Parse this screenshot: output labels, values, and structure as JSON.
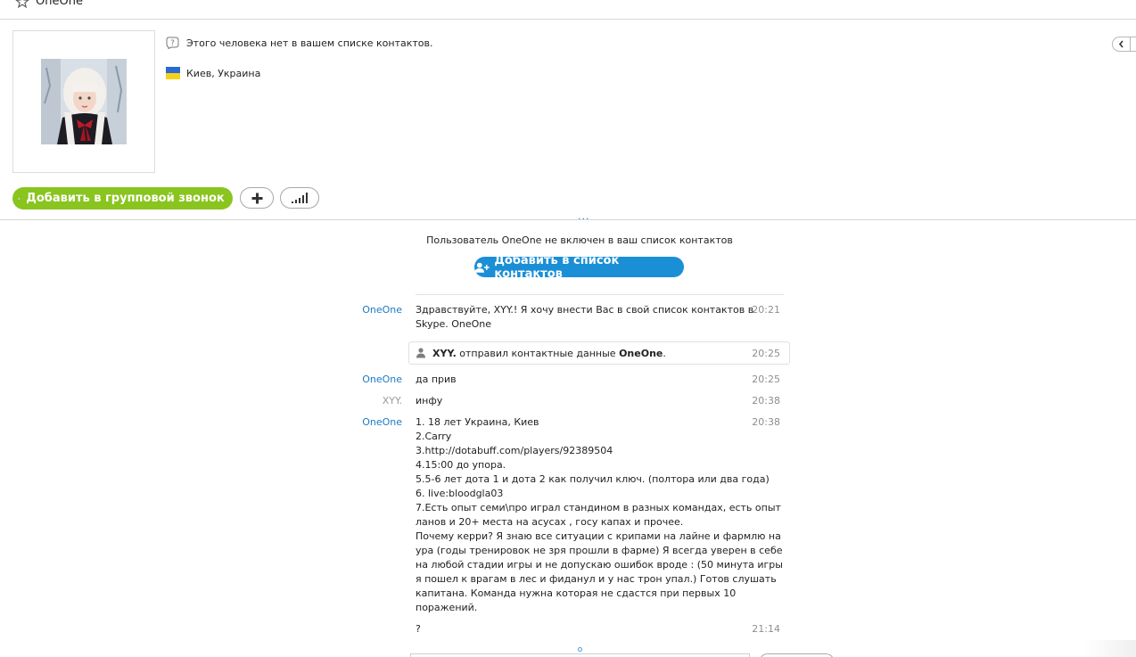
{
  "window": {
    "title": "OneOne"
  },
  "profile": {
    "not_in_contacts": "Этого человека нет в вашем списке контактов.",
    "location": "Киев, Украина",
    "avatar_icon": "user-photo"
  },
  "toolbar": {
    "group_call_label": "Добавить в групповой звонок",
    "add_icon": "plus-icon",
    "signal_icon": "signal-bars-icon"
  },
  "splitter": {
    "grip": "..."
  },
  "chat": {
    "notice": "Пользователь OneOne не включен в ваш список контактов",
    "add_contact_label": "Добавить в список контактов",
    "messages": [
      {
        "sender": "OneOne",
        "time": "20:21",
        "lines": [
          "Здравствуйте, XYY.! Я хочу внести Вас в свой список контактов в",
          "Skype. OneOne"
        ]
      },
      {
        "sender": "OneOne",
        "time": "20:25",
        "lines": [
          "да прив"
        ]
      },
      {
        "sender": "XYY.",
        "time": "20:38",
        "lines": [
          "инфу"
        ]
      },
      {
        "sender": "OneOne",
        "time": "20:38",
        "lines": [
          "1. 18 лет Украина, Киев",
          "2.Carry",
          "3.http://dotabuff.com/players/92389504",
          "4.15:00 до упора.",
          "5.5-6 лет дота 1 и дота 2 как получил ключ. (полтора или два года)",
          "6. live:bloodgla03",
          "7.Есть опыт семи\\про играл стандином в разных командах, есть опыт",
          "ланов и 20+ места на асусах , госу капах и прочее.",
          "Почему керри? Я знаю все ситуации с крипами на лайне и фармлю на",
          "ура (годы тренировок не зря прошли в фарме) Я всегда уверен в себе",
          "на любой стадии игры и не допускаю ошибок вроде : (50 минута игры",
          "я пошел к врагам в лес и фиданул и у нас трон упал.) Готов слушать",
          "капитана. Команда нужна которая не сдастся при первых 10",
          "поражений."
        ]
      },
      {
        "sender": "",
        "time": "21:14",
        "lines": [
          "?"
        ]
      }
    ],
    "system_event": {
      "actor": "XYY.",
      "text": " отправил контактные данные ",
      "target": "OneOne",
      "end": ".",
      "time": "20:25"
    }
  },
  "colors": {
    "skype_blue": "#1a8fd6",
    "call_green": "#8ac41f",
    "sender_blue": "#1b7ac4",
    "ukraine_blue": "#2a6ad1",
    "ukraine_yellow": "#f4d21c"
  }
}
